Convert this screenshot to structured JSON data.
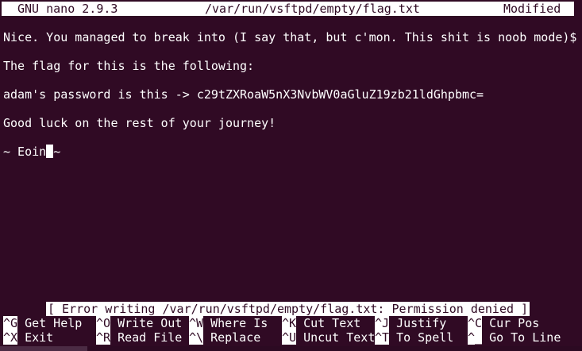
{
  "titlebar": {
    "app": "GNU nano 2.9.3",
    "file": "/var/run/vsftpd/empty/flag.txt",
    "status": "Modified"
  },
  "buffer": {
    "lines": [
      "Nice. You managed to break into (I say that, but c'mon. This shit is noob mode)$",
      "The flag for this is the following:",
      "adam's password is this -> c29tZXRoaW5nX3NvbWV0aGluZ19zb21ldGhpbmc=",
      "Good luck on the rest of your journey!"
    ],
    "last_line_before_cursor": "~ Eoin",
    "last_line_after_cursor": "~"
  },
  "status_message": "[ Error writing /var/run/vsftpd/empty/flag.txt: Permission denied ]",
  "shortcuts": {
    "row1": [
      {
        "key": "^G",
        "label": "Get Help"
      },
      {
        "key": "^O",
        "label": "Write Out"
      },
      {
        "key": "^W",
        "label": "Where Is"
      },
      {
        "key": "^K",
        "label": "Cut Text"
      },
      {
        "key": "^J",
        "label": "Justify"
      },
      {
        "key": "^C",
        "label": "Cur Pos"
      }
    ],
    "row2": [
      {
        "key": "^X",
        "label": "Exit"
      },
      {
        "key": "^R",
        "label": "Read File"
      },
      {
        "key": "^\\",
        "label": "Replace"
      },
      {
        "key": "^U",
        "label": "Uncut Text"
      },
      {
        "key": "^T",
        "label": "To Spell"
      },
      {
        "key": "^_",
        "label": "Go To Line"
      }
    ]
  },
  "colors": {
    "background": "#300a24",
    "foreground": "#ffffff"
  }
}
